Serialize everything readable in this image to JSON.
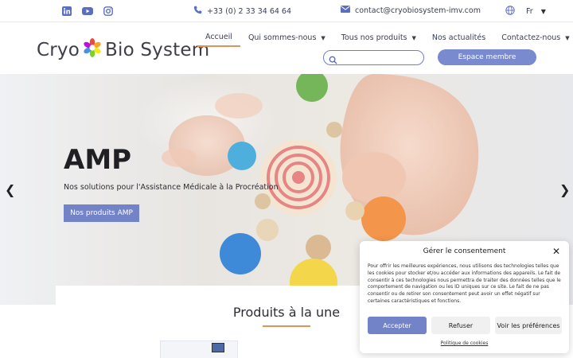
{
  "topbar": {
    "social": [
      {
        "icon": "linkedin-icon"
      },
      {
        "icon": "youtube-icon"
      },
      {
        "icon": "instagram-icon"
      }
    ],
    "phone": "+33 (0) 2 33 34 64 64",
    "email": "contact@cryobiosystem-imv.com",
    "language": "Fr"
  },
  "header": {
    "logo_left": "Cryo",
    "logo_right": "Bio System",
    "nav": [
      {
        "label": "Accueil",
        "active": true
      },
      {
        "label": "Qui sommes-nous",
        "dropdown": true
      },
      {
        "label": "Tous nos produits",
        "dropdown": true
      },
      {
        "label": "Nos actualités"
      },
      {
        "label": "Contactez-nous",
        "dropdown": true
      }
    ],
    "search_placeholder": "",
    "member_button": "Espace membre"
  },
  "hero": {
    "title": "AMP",
    "subtitle": "Nos solutions pour l'Assistance Médicale à la Procréation",
    "button": "Nos produits AMP",
    "prev_icon": "chevron-left-icon",
    "next_icon": "chevron-right-icon"
  },
  "products": {
    "title": "Produits à la une"
  },
  "consent": {
    "title": "Gérer le consentement",
    "text": "Pour offrir les meilleures expériences, nous utilisons des technologies telles que les cookies pour stocker et/ou accéder aux informations des appareils. Le fait de consentir à ces technologies nous permettra de traiter des données telles que le comportement de navigation ou les ID uniques sur ce site. Le fait de ne pas consentir ou de retirer son consentement peut avoir un effet négatif sur certaines caractéristiques et fonctions.",
    "accept": "Accepter",
    "refuse": "Refuser",
    "preferences": "Voir les préférences",
    "policy_link": "Politique de cookies"
  },
  "colors": {
    "accent": "#7383c7",
    "underline": "#d9955a",
    "icon_blue": "#5b6fbf"
  }
}
